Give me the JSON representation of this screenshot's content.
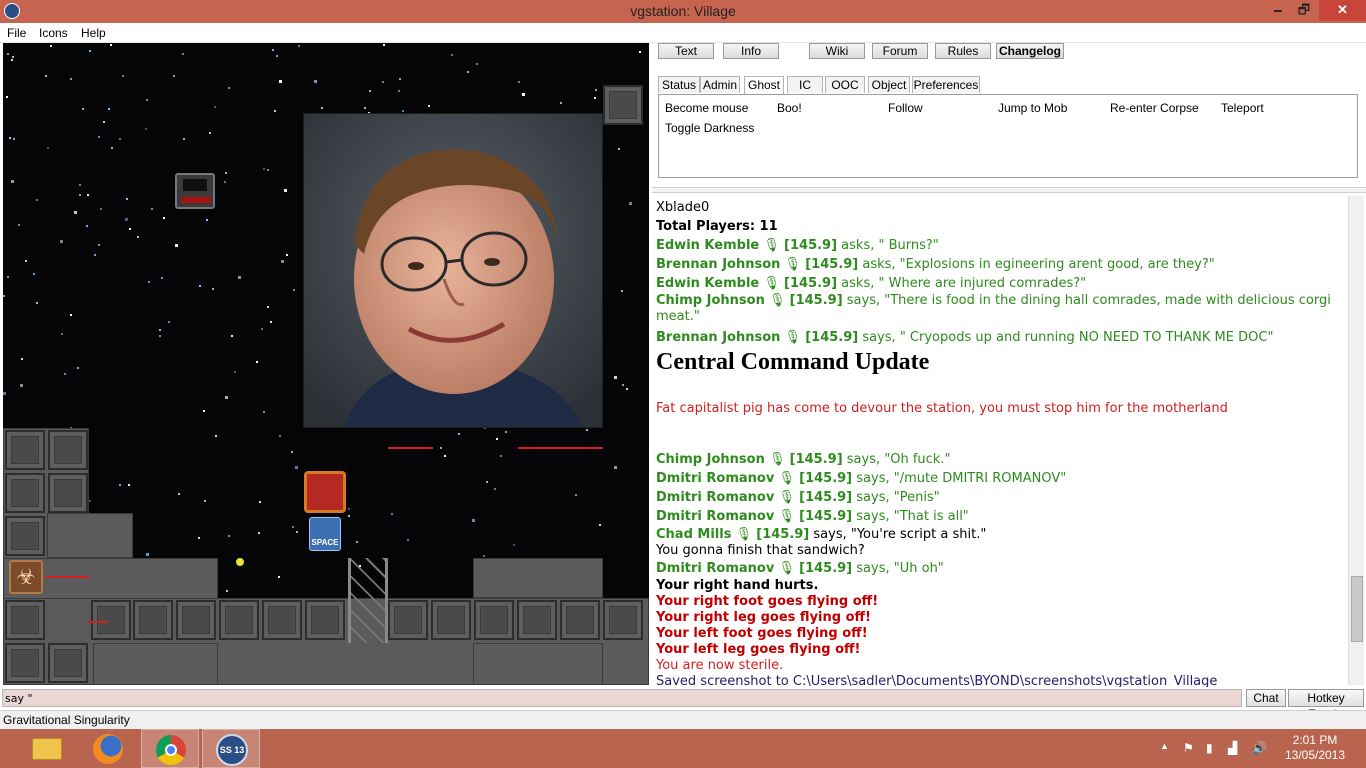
{
  "window": {
    "title": "vgstation: Village",
    "minimize": "🗕",
    "maximize": "🗗",
    "close": "✕"
  },
  "menu": [
    "File",
    "Icons",
    "Help"
  ],
  "top_buttons": [
    "Text",
    "Info",
    "Wiki",
    "Forum",
    "Rules",
    "Changelog"
  ],
  "tabs": [
    "Status",
    "Admin",
    "Ghost",
    "IC",
    "OOC",
    "Object",
    "Preferences"
  ],
  "active_tab": "Ghost",
  "verbs": [
    "Become mouse",
    "Boo!",
    "Follow",
    "Jump to Mob",
    "Re-enter Corpse",
    "Teleport",
    "Toggle Darkness"
  ],
  "map_labels": {
    "space_sign": "SPACE"
  },
  "chat": {
    "l0": "Xblade0",
    "l1": "Total Players: 11",
    "m1": {
      "name": "Edwin Kemble",
      "freq": "[145.9]",
      "text": " asks, \" Burns?\""
    },
    "m2": {
      "name": "Brennan Johnson",
      "freq": "[145.9]",
      "text": " asks, \"Explosions in egineering arent good, are they?\""
    },
    "m3": {
      "name": "Edwin Kemble",
      "freq": "[145.9]",
      "text": " asks, \" Where are injured comrades?\""
    },
    "m4": {
      "name": "Chimp Johnson",
      "freq": "[145.9]",
      "text": " says, \"There is food in the dining hall comrades, made with delicious corgi meat.\""
    },
    "m5": {
      "name": "Brennan Johnson",
      "freq": "[145.9]",
      "text": " says, \" Cryopods up and running NO NEED TO THANK ME DOC\""
    },
    "announce_header": "Central Command Update",
    "announce_text": "Fat capitalist pig has come to devour the station, you must stop him for the motherland",
    "m6": {
      "name": "Chimp Johnson",
      "freq": "[145.9]",
      "text": " says, \"Oh fuck.\""
    },
    "m7": {
      "name": "Dmitri Romanov",
      "freq": "[145.9]",
      "text": " says, \"/mute DMITRI ROMANOV\""
    },
    "m8": {
      "name": "Dmitri Romanov",
      "freq": "[145.9]",
      "text": " says, \"Penis\""
    },
    "m9": {
      "name": "Dmitri Romanov",
      "freq": "[145.9]",
      "text": " says, \"That is all\""
    },
    "m10": {
      "name": "Chad Mills",
      "freq": "[145.9]",
      "text": " says, \"You're script a shit.\""
    },
    "l2": "You gonna finish that sandwich?",
    "m11": {
      "name": "Dmitri Romanov",
      "freq": "[145.9]",
      "text": " says, \"Uh oh\""
    },
    "l3": "Your right hand hurts.",
    "l4": "Your right foot goes flying off!",
    "l5": "Your right leg goes flying off!",
    "l6": "Your left foot goes flying off!",
    "l7": "Your left leg goes flying off!",
    "l8": "You are now sterile.",
    "l9": "Saved screenshot to C:\\Users\\sadler\\Documents\\BYOND\\screenshots\\vgstation_Village"
  },
  "input": {
    "value": "say \""
  },
  "buttons": {
    "chat": "Chat",
    "hotkey": "Hotkey Toggle"
  },
  "status": "Gravitational Singularity",
  "taskbar": {
    "apps": [
      "explorer-icon",
      "firefox-icon",
      "chrome-icon",
      "ss13-icon"
    ],
    "ss13_label": "SS 13",
    "time": "2:01 PM",
    "date": "13/05/2013",
    "tray_arrow": "▲"
  },
  "colors": {
    "titlebar": "#c6644f",
    "taskbar": "#b8644f",
    "speech_green": "#2e8b1e",
    "alert_red": "#d21f1f"
  }
}
